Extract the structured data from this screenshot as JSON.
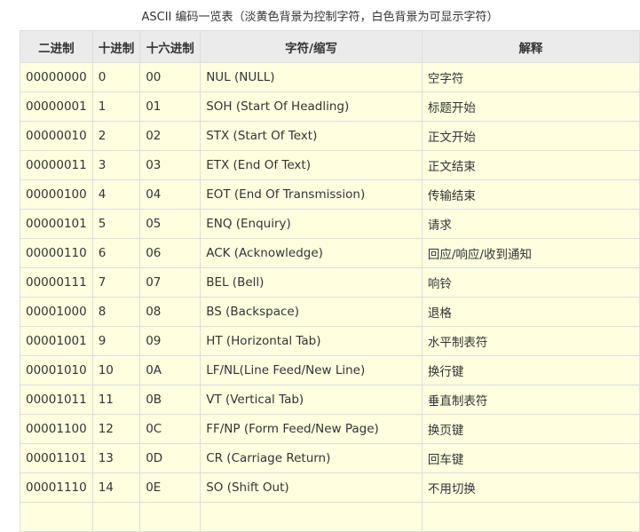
{
  "caption": "ASCII 编码一览表（淡黄色背景为控制字符，白色背景为可显示字符）",
  "table": {
    "headers": [
      "二进制",
      "十进制",
      "十六进制",
      "字符/缩写",
      "解释"
    ],
    "rows": [
      [
        "00000000",
        "0",
        "00",
        "NUL (NULL)",
        "空字符"
      ],
      [
        "00000001",
        "1",
        "01",
        "SOH (Start Of Headling)",
        "标题开始"
      ],
      [
        "00000010",
        "2",
        "02",
        "STX (Start Of Text)",
        "正文开始"
      ],
      [
        "00000011",
        "3",
        "03",
        "ETX (End Of Text)",
        "正文结束"
      ],
      [
        "00000100",
        "4",
        "04",
        "EOT (End Of Transmission)",
        "传输结束"
      ],
      [
        "00000101",
        "5",
        "05",
        "ENQ (Enquiry)",
        "请求"
      ],
      [
        "00000110",
        "6",
        "06",
        "ACK (Acknowledge)",
        "回应/响应/收到通知"
      ],
      [
        "00000111",
        "7",
        "07",
        "BEL (Bell)",
        "响铃"
      ],
      [
        "00001000",
        "8",
        "08",
        "BS (Backspace)",
        "退格"
      ],
      [
        "00001001",
        "9",
        "09",
        "HT (Horizontal Tab)",
        "水平制表符"
      ],
      [
        "00001010",
        "10",
        "0A",
        "LF/NL(Line Feed/New Line)",
        "换行键"
      ],
      [
        "00001011",
        "11",
        "0B",
        "VT (Vertical Tab)",
        "垂直制表符"
      ],
      [
        "00001100",
        "12",
        "0C",
        "FF/NP (Form Feed/New Page)",
        "换页键"
      ],
      [
        "00001101",
        "13",
        "0D",
        "CR (Carriage Return)",
        "回车键"
      ],
      [
        "00001110",
        "14",
        "0E",
        "SO (Shift Out)",
        "不用切换"
      ],
      [
        "",
        "",
        "",
        "",
        ""
      ]
    ]
  },
  "colors": {
    "control_char_bg": "#ffffe0",
    "header_bg": "#ebebeb",
    "border": "#dddddd"
  }
}
